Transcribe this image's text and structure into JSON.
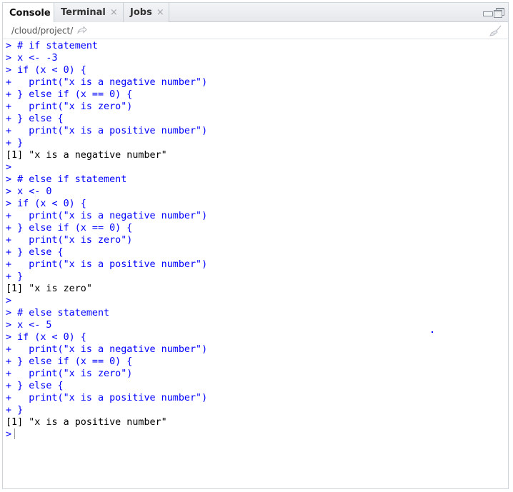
{
  "tabs": [
    {
      "label": "Console",
      "closable": false
    },
    {
      "label": "Terminal",
      "closable": true
    },
    {
      "label": "Jobs",
      "closable": true
    }
  ],
  "close_glyph": "×",
  "path": "/cloud/project/",
  "icons": {
    "path_link": "share-arrow-icon",
    "clear": "broom-icon",
    "minimize": "minimize-icon",
    "maximize": "maximize-icon"
  },
  "colors": {
    "input": "#0000ff",
    "output": "#000000"
  },
  "console_lines": [
    {
      "kind": "in",
      "text": "> # if statement"
    },
    {
      "kind": "in",
      "text": "> x <- -3"
    },
    {
      "kind": "in",
      "text": "> if (x < 0) {"
    },
    {
      "kind": "in",
      "text": "+   print(\"x is a negative number\")"
    },
    {
      "kind": "in",
      "text": "+ } else if (x == 0) {"
    },
    {
      "kind": "in",
      "text": "+   print(\"x is zero\")"
    },
    {
      "kind": "in",
      "text": "+ } else {"
    },
    {
      "kind": "in",
      "text": "+   print(\"x is a positive number\")"
    },
    {
      "kind": "in",
      "text": "+ }"
    },
    {
      "kind": "out",
      "text": "[1] \"x is a negative number\""
    },
    {
      "kind": "in",
      "text": ">"
    },
    {
      "kind": "in",
      "text": "> # else if statement"
    },
    {
      "kind": "in",
      "text": "> x <- 0"
    },
    {
      "kind": "in",
      "text": "> if (x < 0) {"
    },
    {
      "kind": "in",
      "text": "+   print(\"x is a negative number\")"
    },
    {
      "kind": "in",
      "text": "+ } else if (x == 0) {"
    },
    {
      "kind": "in",
      "text": "+   print(\"x is zero\")"
    },
    {
      "kind": "in",
      "text": "+ } else {"
    },
    {
      "kind": "in",
      "text": "+   print(\"x is a positive number\")"
    },
    {
      "kind": "in",
      "text": "+ }"
    },
    {
      "kind": "out",
      "text": "[1] \"x is zero\""
    },
    {
      "kind": "in",
      "text": ">"
    },
    {
      "kind": "in",
      "text": "> # else statement"
    },
    {
      "kind": "in",
      "text": "> x <- 5"
    },
    {
      "kind": "in",
      "text": "> if (x < 0) {"
    },
    {
      "kind": "in",
      "text": "+   print(\"x is a negative number\")"
    },
    {
      "kind": "in",
      "text": "+ } else if (x == 0) {"
    },
    {
      "kind": "in",
      "text": "+   print(\"x is zero\")"
    },
    {
      "kind": "in",
      "text": "+ } else {"
    },
    {
      "kind": "in",
      "text": "+   print(\"x is a positive number\")"
    },
    {
      "kind": "in",
      "text": "+ }"
    },
    {
      "kind": "out",
      "text": "[1] \"x is a positive number\""
    }
  ],
  "prompt": ">"
}
